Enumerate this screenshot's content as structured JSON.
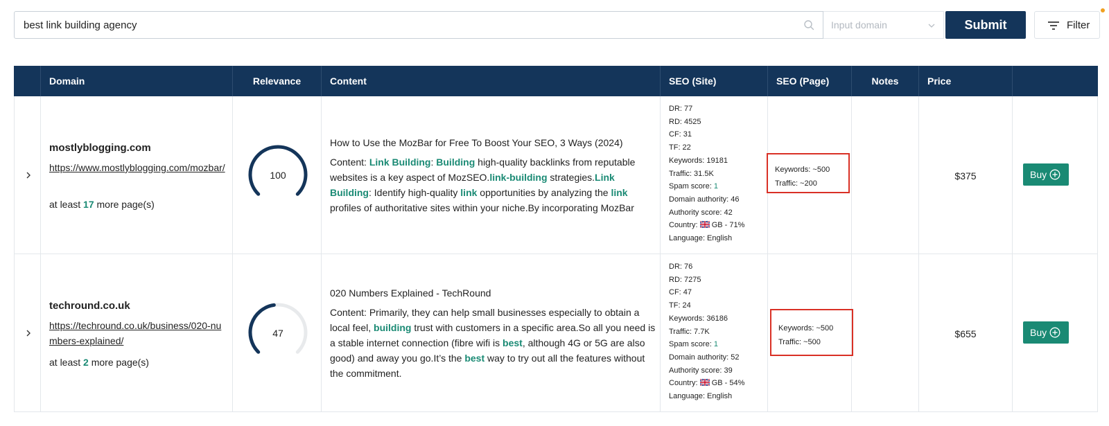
{
  "search": {
    "query": "best link building agency",
    "domain_placeholder": "Input domain",
    "submit_label": "Submit",
    "filter_label": "Filter"
  },
  "columns": [
    "Domain",
    "Relevance",
    "Content",
    "SEO (Site)",
    "SEO (Page)",
    "Notes",
    "Price"
  ],
  "rows": [
    {
      "domain": "mostlyblogging.com",
      "url": "https://www.mostlyblogging.com/mozbar/",
      "more_prefix": "at least ",
      "more_count": "17",
      "more_suffix": " more page(s)",
      "relevance": 100,
      "relevance_label": "100",
      "title": "How to Use the MozBar for Free To Boost Your SEO, 3 Ways (2024)",
      "content": [
        {
          "t": "Content: "
        },
        {
          "t": "Link Building",
          "hl": true
        },
        {
          "t": ": "
        },
        {
          "t": "Building",
          "hl": true
        },
        {
          "t": " high-quality backlinks from reputable websites is a key aspect of MozSEO."
        },
        {
          "t": "link-building",
          "hl": true
        },
        {
          "t": " strategies."
        },
        {
          "t": "Link Building",
          "hl": true
        },
        {
          "t": ": Identify high-quality "
        },
        {
          "t": "link",
          "hl": true
        },
        {
          "t": " opportunities by analyzing the "
        },
        {
          "t": "link",
          "hl": true
        },
        {
          "t": " profiles of authoritative sites within your niche.By incorporating MozBar"
        }
      ],
      "seo_site": {
        "dr": "DR: 77",
        "rd": "RD: 4525",
        "cf": "CF: 31",
        "tf": "TF: 22",
        "keywords": "Keywords: 19181",
        "traffic": "Traffic: 31.5K",
        "spam_label": "Spam score: ",
        "spam_value": "1",
        "domain_authority": "Domain authority: 46",
        "authority_score": "Authority score: 42",
        "country_label": "Country: ",
        "country_value": "GB - 71%",
        "language": "Language: English"
      },
      "seo_page": {
        "keywords": "Keywords: ~500",
        "traffic": "Traffic: ~200"
      },
      "price": "$375",
      "buy_label": "Buy"
    },
    {
      "domain": "techround.co.uk",
      "url": "https://techround.co.uk/business/020-numbers-explained/",
      "more_prefix": "at least ",
      "more_count": "2",
      "more_suffix": " more page(s)",
      "relevance": 47,
      "relevance_label": "47",
      "title": "020 Numbers Explained - TechRound",
      "content": [
        {
          "t": "Content: Primarily, they can help small businesses especially to obtain a local feel, "
        },
        {
          "t": "building",
          "hl": true
        },
        {
          "t": " trust with customers in a specific area.So all you need is a stable internet connection (fibre wifi is "
        },
        {
          "t": "best",
          "hl": true
        },
        {
          "t": ", although 4G or 5G are also good) and away you go.It’s the "
        },
        {
          "t": "best",
          "hl": true
        },
        {
          "t": " way to try out all the features without the commitment."
        }
      ],
      "seo_site": {
        "dr": "DR: 76",
        "rd": "RD: 7275",
        "cf": "CF: 47",
        "tf": "TF: 24",
        "keywords": "Keywords: 36186",
        "traffic": "Traffic: 7.7K",
        "spam_label": "Spam score: ",
        "spam_value": "1",
        "domain_authority": "Domain authority: 52",
        "authority_score": "Authority score: 39",
        "country_label": "Country: ",
        "country_value": "GB - 54%",
        "language": "Language: English"
      },
      "seo_page": {
        "keywords": "Keywords: ~500",
        "traffic": "Traffic: ~500"
      },
      "price": "$655",
      "buy_label": "Buy"
    }
  ],
  "colors": {
    "header_bg": "#14355a",
    "accent_green": "#1a8a74",
    "highlight_box": "#d93025",
    "notification_dot": "#f0a020"
  },
  "icons": [
    "search-icon",
    "chevron-down-icon",
    "filter-icon",
    "chevron-right-icon",
    "plus-circle-icon",
    "uk-flag-icon"
  ]
}
